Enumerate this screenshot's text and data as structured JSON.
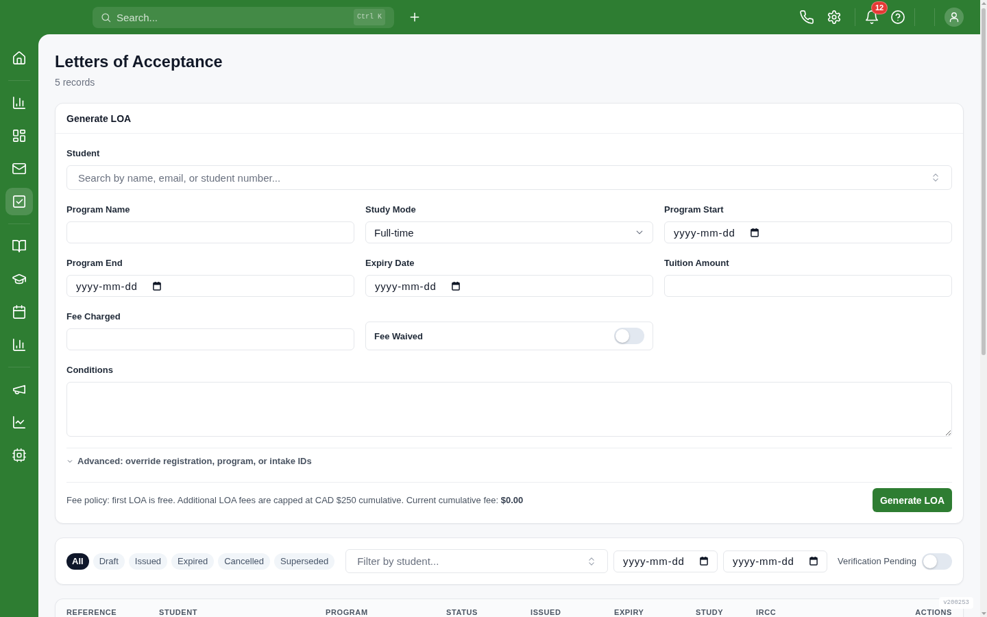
{
  "topbar": {
    "search": {
      "placeholder": "Search...",
      "shortcut": "Ctrl K"
    },
    "notification_count": "12"
  },
  "sidebar": {
    "groups": [
      {
        "items": [
          {
            "selected": false
          }
        ]
      },
      {
        "items": [
          {
            "selected": false
          },
          {
            "selected": false
          },
          {
            "selected": false
          },
          {
            "selected": true
          }
        ]
      },
      {
        "items": [
          {
            "selected": false
          },
          {
            "selected": false
          },
          {
            "selected": false
          },
          {
            "selected": false
          }
        ]
      },
      {
        "items": [
          {
            "selected": false
          },
          {
            "selected": false
          },
          {
            "selected": false
          }
        ]
      }
    ]
  },
  "page": {
    "title": "Letters of Acceptance",
    "subtitle": "5 records"
  },
  "form": {
    "title": "Generate LOA",
    "student": {
      "label": "Student",
      "placeholder": "Search by name, email, or student number..."
    },
    "fields": [
      {
        "kind": "text",
        "label": "Program Name"
      },
      {
        "kind": "select",
        "label": "Study Mode",
        "value": "Full-time"
      },
      {
        "kind": "date",
        "label": "Program Start",
        "placeholder": "yyyy-mm-dd"
      },
      {
        "kind": "date",
        "label": "Program End",
        "placeholder": "yyyy-mm-dd"
      },
      {
        "kind": "date",
        "label": "Expiry Date",
        "placeholder": "yyyy-mm-dd"
      },
      {
        "kind": "text",
        "label": "Tuition Amount"
      },
      {
        "kind": "text",
        "label": "Fee Charged"
      },
      {
        "kind": "toggle",
        "label": "Fee Waived",
        "on": false
      }
    ],
    "conditions": {
      "label": "Conditions"
    },
    "advanced": {
      "label": "Advanced: override registration, program, or intake IDs",
      "expanded": false
    },
    "fee_policy": "Fee policy: first LOA is free. Additional LOA fees are capped at CAD $250 cumulative. Current cumulative fee: **$0.00**",
    "submit": "Generate LOA"
  },
  "filters": {
    "statuses": [
      {
        "label": "All",
        "selected": true
      },
      {
        "label": "Draft",
        "selected": false
      },
      {
        "label": "Issued",
        "selected": false
      },
      {
        "label": "Expired",
        "selected": false
      },
      {
        "label": "Cancelled",
        "selected": false
      },
      {
        "label": "Superseded",
        "selected": false
      }
    ],
    "student": {
      "placeholder": "Filter by student..."
    },
    "date_from": {
      "placeholder": "yyyy-mm-dd"
    },
    "date_to": {
      "placeholder": "yyyy-mm-dd"
    },
    "verification_pending": {
      "label": "Verification Pending",
      "on": false
    }
  },
  "table": {
    "columns": [
      "REFERENCE",
      "STUDENT",
      "PROGRAM",
      "STATUS",
      "ISSUED",
      "EXPIRY",
      "STUDY",
      "IRCC",
      "ACTIONS"
    ]
  },
  "version": "v200253"
}
